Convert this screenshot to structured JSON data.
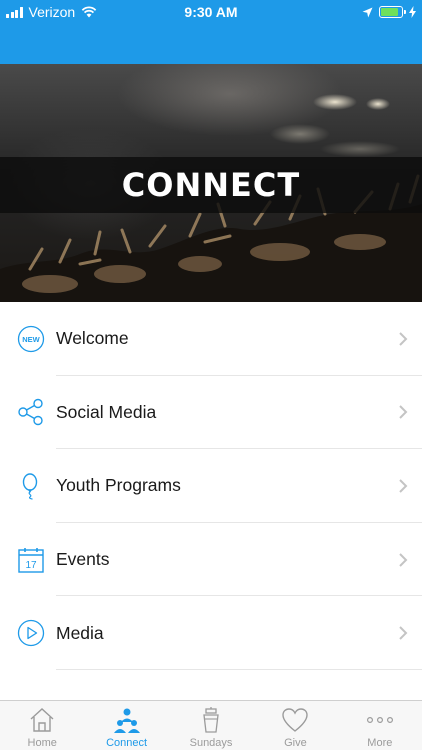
{
  "status_bar": {
    "carrier": "Verizon",
    "time": "9:30 AM",
    "battery_level": 0.85,
    "background_color": "#1e9ae8"
  },
  "hero": {
    "title": "CONNECT"
  },
  "menu": {
    "items": [
      {
        "label": "Welcome",
        "icon": "new-badge-icon"
      },
      {
        "label": "Social Media",
        "icon": "share-icon"
      },
      {
        "label": "Youth Programs",
        "icon": "balloon-icon"
      },
      {
        "label": "Events",
        "icon": "calendar-icon",
        "icon_text": "17"
      },
      {
        "label": "Media",
        "icon": "play-circle-icon"
      }
    ],
    "badge_text": "NEW",
    "accent_color": "#1e9ae8"
  },
  "tab_bar": {
    "active": "Connect",
    "tabs": [
      {
        "label": "Home",
        "icon": "house-icon"
      },
      {
        "label": "Connect",
        "icon": "people-icon"
      },
      {
        "label": "Sundays",
        "icon": "podium-icon"
      },
      {
        "label": "Give",
        "icon": "heart-icon"
      },
      {
        "label": "More",
        "icon": "ellipsis-icon"
      }
    ]
  }
}
